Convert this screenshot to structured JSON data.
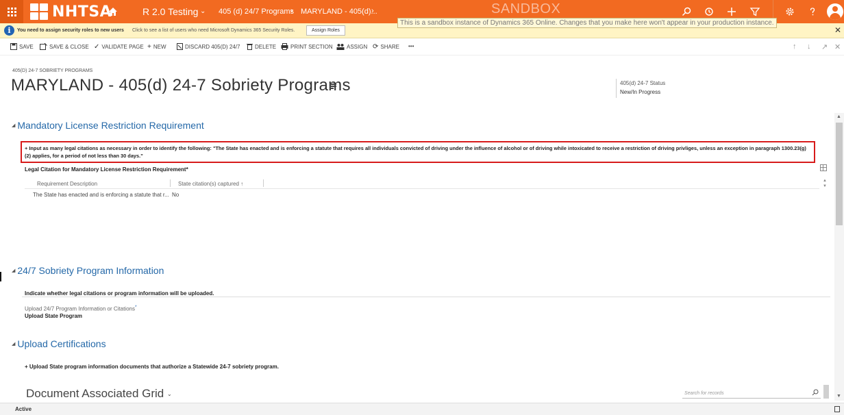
{
  "topbar": {
    "brand": "NHTSA",
    "app_name": "R 2.0 Testing",
    "app_chevron": "⌄",
    "breadcrumb": [
      "405 (d) 24/7 Programs",
      "MARYLAND - 405(d)..."
    ],
    "crumb_sep": "›",
    "sandbox_title": "SANDBOX",
    "sandbox_note": "This is a sandbox instance of Dynamics 365 Online.  Changes that you make here won't appear in your production instance.",
    "accent_color": "#f26a21",
    "icons": [
      "search-icon",
      "history-icon",
      "plus-icon",
      "filter-icon",
      "gear-icon",
      "help-icon",
      "user-avatar"
    ]
  },
  "notification": {
    "bold_text": "You need to assign security roles to new users",
    "text": "Click to see a list of users who need Microsoft Dynamics 365 Security Roles.",
    "button_label": "Assign Roles",
    "close_glyph": "✕"
  },
  "commands": {
    "save": "SAVE",
    "save_close": "SAVE & CLOSE",
    "validate": "VALIDATE PAGE",
    "new": "NEW",
    "discard": "DISCARD 405(D) 24/7",
    "delete": "DELETE",
    "print": "PRINT SECTION",
    "assign": "ASSIGN",
    "share": "SHARE",
    "more": "•••"
  },
  "record": {
    "entity_label": "405(D) 24-7 SOBRIETY PROGRAMS",
    "title": "MARYLAND - 405(d) 24-7 Sobriety Programs",
    "status_label": "405(d) 24-7 Status",
    "status_value": "New/In Progress"
  },
  "sections": {
    "mandatory": {
      "title": "Mandatory License Restriction Requirement",
      "instruction": "+ Input as many legal citations as necessary in order to identify the following: \"The State has enacted and is enforcing a statute that requires all individuals convicted of driving under the influence of alcohol or of driving while intoxicated to receive a restriction of driving privliges, unless an exception in paragraph 1300.23(g)(2) applies, for a period of not less than 30 days.\"",
      "grid_label": "Legal Citation for Mandatory License Restriction Requirement*",
      "columns": [
        "Requirement Description",
        "State citation(s) captured ↑"
      ],
      "rows": [
        {
          "description": "The State has enacted and is enforcing a statute that r...",
          "captured": "No"
        }
      ]
    },
    "sobriety": {
      "title": "24/7 Sobriety Program Information",
      "indicate_text": "Indicate whether legal citations or program information will be uploaded.",
      "upload_label": "Upload 24/7 Program Information or Citations",
      "required_marker": "*",
      "upload_value": "Upload State Program"
    },
    "certifications": {
      "title": "Upload Certifications",
      "instruction": "+ Upload State program information documents that authorize a Statewide 24-7 sobriety program.",
      "doc_grid_title": "Document Associated Grid",
      "search_placeholder": "Search for records"
    }
  },
  "statusbar": {
    "status": "Active"
  }
}
